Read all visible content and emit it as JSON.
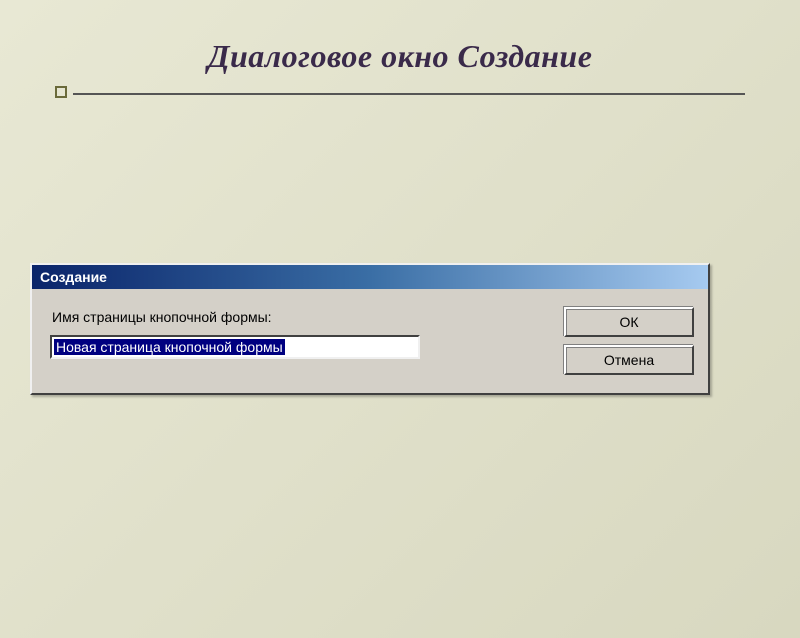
{
  "slide": {
    "title": "Диалоговое окно Создание"
  },
  "dialog": {
    "title": "Создание",
    "field_label": "Имя страницы кнопочной формы:",
    "field_value": "Новая страница кнопочной формы",
    "ok_label": "ОК",
    "cancel_label": "Отмена"
  }
}
